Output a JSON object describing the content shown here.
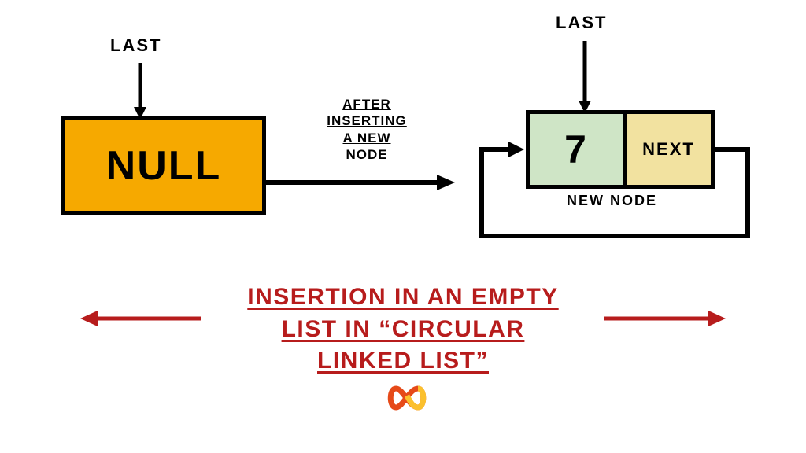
{
  "left": {
    "last_label": "Last",
    "null_label": "NULL"
  },
  "transition": {
    "caption_l1": "After",
    "caption_l2": "Inserting",
    "caption_l3": "a new",
    "caption_l4": "node"
  },
  "right": {
    "last_label": "Last",
    "node_value": "7",
    "node_next_label": "next",
    "new_node_label": "New node"
  },
  "title": {
    "line1": "Insertion in an empty",
    "line2": "list in “circular",
    "line3": "linked list”"
  },
  "colors": {
    "null_fill": "#f6a900",
    "data_fill": "#cfe5c6",
    "next_fill": "#f2e2a0",
    "title_red": "#b71c1c"
  }
}
